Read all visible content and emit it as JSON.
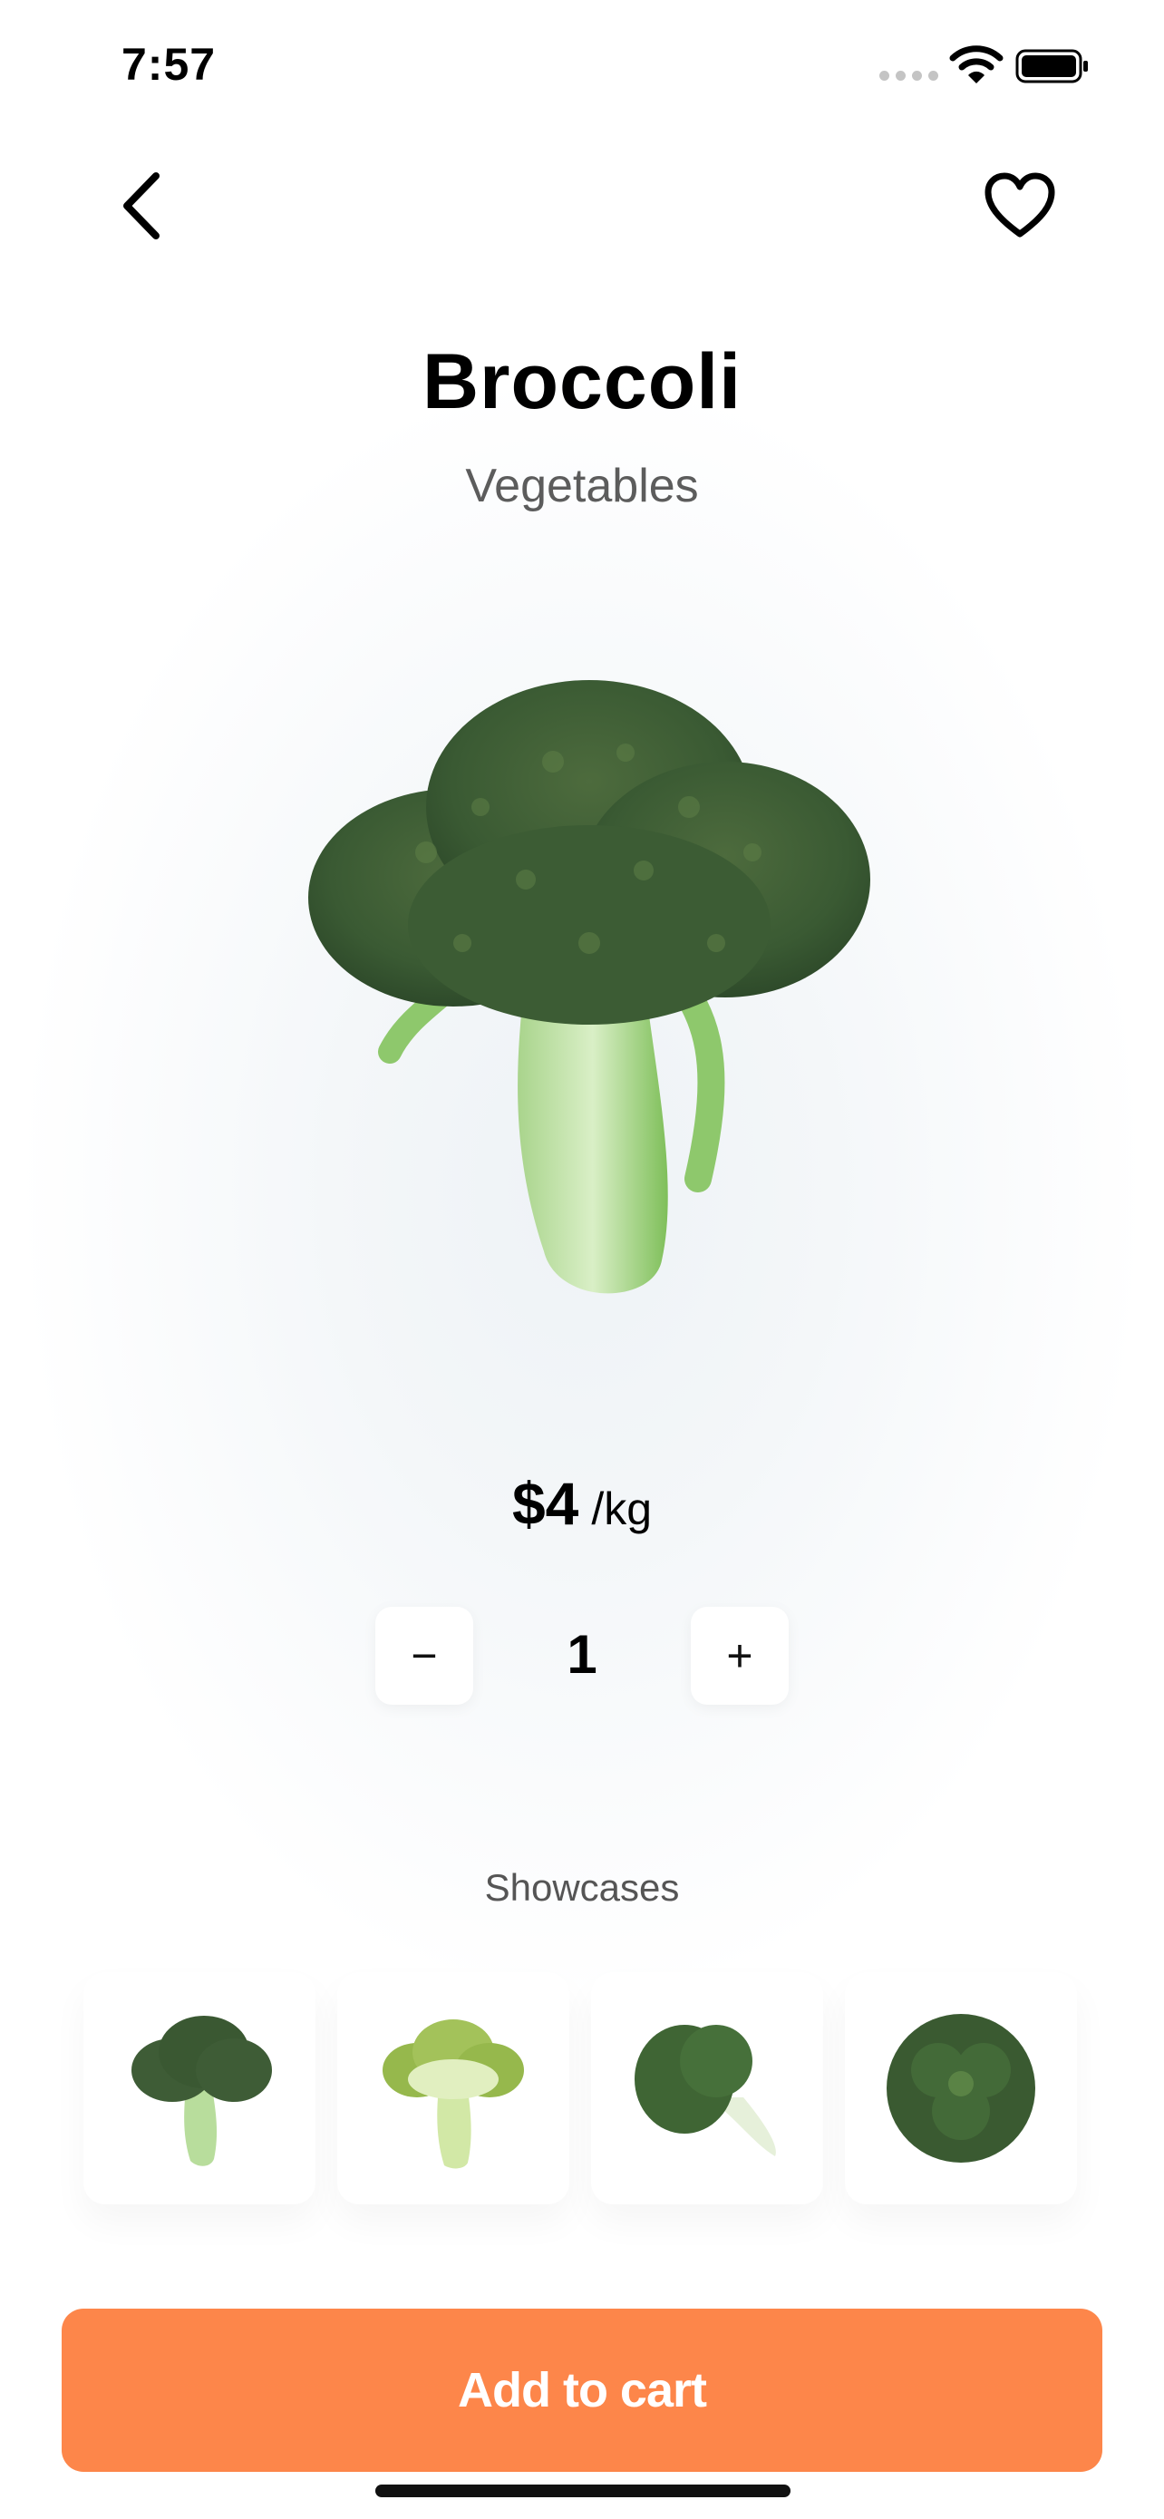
{
  "status_bar": {
    "time": "7:57"
  },
  "header": {
    "back_icon": "chevron-left-icon",
    "favorite_icon": "heart-outline-icon"
  },
  "product": {
    "name": "Broccoli",
    "category": "Vegetables",
    "price": "$4",
    "unit": "/kg"
  },
  "quantity": {
    "decrement_label": "−",
    "value": "1",
    "increment_label": "+"
  },
  "showcases": {
    "label": "Showcases",
    "items": [
      "broccoli-whole",
      "broccoli-cross-section",
      "broccoli-side",
      "broccoli-top"
    ]
  },
  "cta": {
    "label": "Add to cart",
    "color": "#fd864a"
  },
  "colors": {
    "accent": "#fd864a",
    "text": "#000000",
    "muted": "#5c5c5c"
  }
}
